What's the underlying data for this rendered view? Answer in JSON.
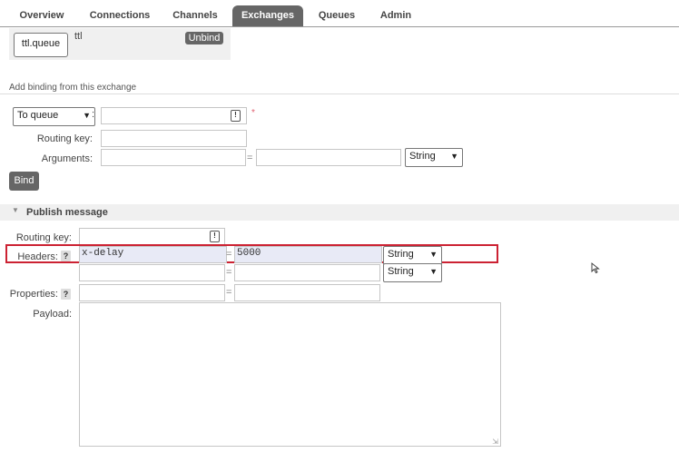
{
  "nav": {
    "tabs": [
      {
        "label": "Overview"
      },
      {
        "label": "Connections"
      },
      {
        "label": "Channels"
      },
      {
        "label": "Exchanges"
      },
      {
        "label": "Queues"
      },
      {
        "label": "Admin"
      }
    ],
    "active": "Exchanges"
  },
  "bindings": {
    "queue_button": "ttl.queue",
    "routing_key": "ttl",
    "unbind_label": "Unbind"
  },
  "add_binding": {
    "section_title": "Add binding from this exchange",
    "destination_select": "To queue",
    "destination_separator": ":",
    "required_marker": "*",
    "routing_key_label": "Routing key:",
    "arguments_label": "Arguments:",
    "arguments_eq": "=",
    "arguments_type": "String",
    "bind_label": "Bind"
  },
  "publish": {
    "section_title": "Publish message",
    "routing_key_label": "Routing key:",
    "headers_label": "Headers:",
    "help": "?",
    "header_rows": [
      {
        "key": "x-delay",
        "eq": "=",
        "value": "5000",
        "type": "String"
      },
      {
        "key": "",
        "eq": "=",
        "value": "",
        "type": "String"
      }
    ],
    "properties_label": "Properties:",
    "properties_eq": "=",
    "payload_label": "Payload:"
  },
  "colors": {
    "active_tab": "#666666",
    "highlight_border": "#cc2233",
    "header_field_bg": "#e8eaf6",
    "required_marker": "#e06070"
  }
}
